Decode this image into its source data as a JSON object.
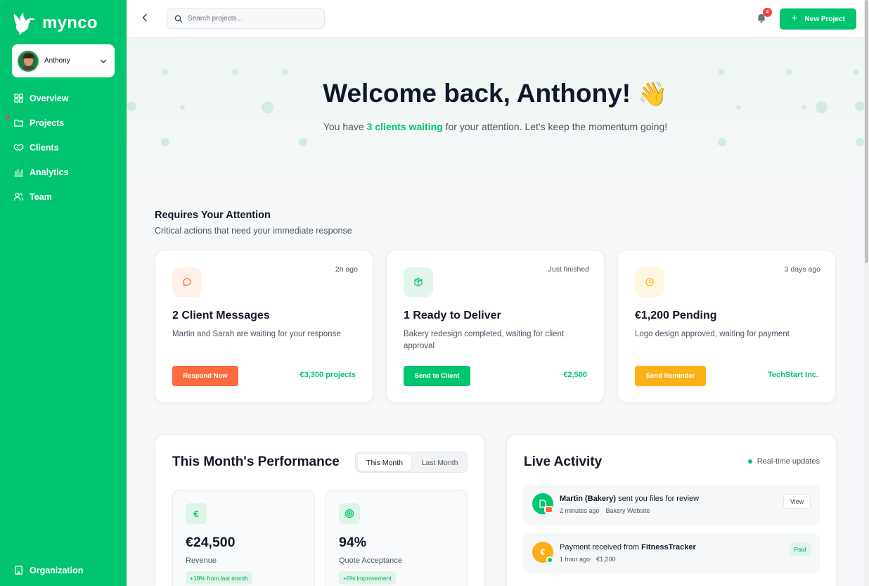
{
  "brand": {
    "name": "mynco"
  },
  "user": {
    "name": "Anthony"
  },
  "sidebar": {
    "items": [
      {
        "label": "Overview",
        "icon": "grid-icon"
      },
      {
        "label": "Projects",
        "icon": "folder-icon"
      },
      {
        "label": "Clients",
        "icon": "handshake-icon"
      },
      {
        "label": "Analytics",
        "icon": "bar-chart-icon"
      },
      {
        "label": "Team",
        "icon": "users-icon"
      }
    ],
    "footer_label": "Organization"
  },
  "topbar": {
    "search_placeholder": "Search projects...",
    "notifications_count": "4",
    "new_project_label": "New Project"
  },
  "hero": {
    "title": "Welcome back, Anthony!",
    "emoji": "👋",
    "subtitle_before": "You have ",
    "subtitle_highlight": "3 clients waiting",
    "subtitle_after": " for your attention. Let's keep the momentum going!"
  },
  "attention": {
    "title": "Requires Your Attention",
    "subtitle": "Critical actions that need your immediate response",
    "cards": [
      {
        "time": "2h ago",
        "title": "2 Client Messages",
        "desc": "Martin and Sarah are waiting for your response",
        "button": "Respond Now",
        "meta": "€3,300 projects",
        "color": "#ff6b3d",
        "icon": "message-icon"
      },
      {
        "time": "Just finished",
        "title": "1 Ready to Deliver",
        "desc": "Bakery redesign completed, waiting for client approval",
        "button": "Send to Client",
        "meta": "€2,500",
        "color": "#00c46f",
        "icon": "package-icon"
      },
      {
        "time": "3 days ago",
        "title": "€1,200 Pending",
        "desc": "Logo design approved, waiting for payment",
        "button": "Send Reminder",
        "meta": "TechStart Inc.",
        "color": "#fbb017",
        "icon": "clock-icon"
      }
    ]
  },
  "performance": {
    "title": "This Month's Performance",
    "tabs": [
      "This Month",
      "Last Month"
    ],
    "stats": [
      {
        "icon": "euro-icon",
        "value": "€24,500",
        "label": "Revenue",
        "chip": "+18% from last month"
      },
      {
        "icon": "target-icon",
        "value": "94%",
        "label": "Quote Acceptance",
        "chip": "+6% improvement"
      }
    ]
  },
  "activity": {
    "title": "Live Activity",
    "status": "Real-time updates",
    "items": [
      {
        "actor": "Martin (Bakery)",
        "text": " sent you files for review",
        "time": "2 minutes ago",
        "context": "Bakery Website",
        "action": "View"
      },
      {
        "prefix": "Payment received from ",
        "actor": "FitnessTracker",
        "time": "1 hour ago",
        "context": "€1,200",
        "badge": "Paid"
      }
    ]
  }
}
